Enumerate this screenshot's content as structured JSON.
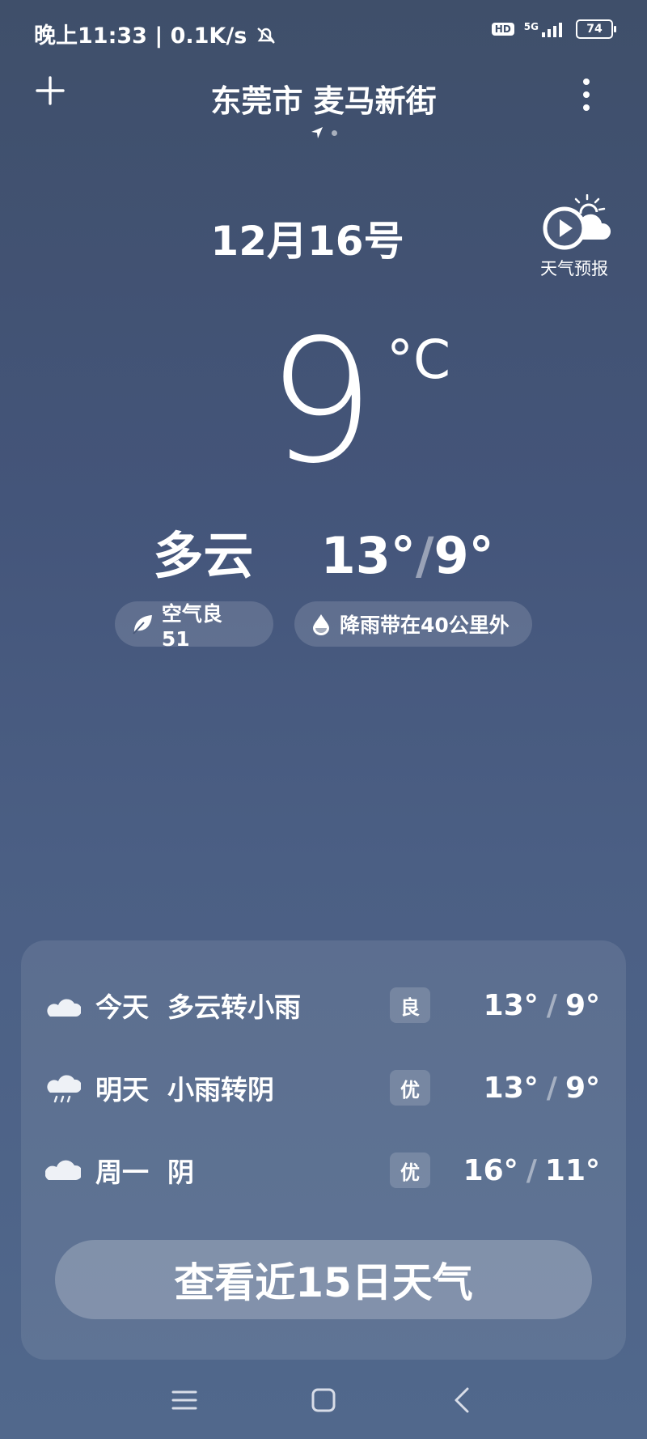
{
  "status_bar": {
    "time_speed": "晚上11:33 | 0.1K/s",
    "hd": "HD",
    "network": "5G",
    "battery": "74"
  },
  "header": {
    "city": "东莞市 麦马新街"
  },
  "date": "12月16号",
  "forecast_video_label": "天气预报",
  "current": {
    "temp": "9",
    "unit": "°C",
    "condition": "多云",
    "high": "13°",
    "low": "9°"
  },
  "chips": {
    "aqi": "空气良 51",
    "rain": "降雨带在40公里外"
  },
  "forecast": [
    {
      "day": "今天",
      "desc": "多云转小雨",
      "aqi": "良",
      "high": "13°",
      "low": "9°",
      "icon": "cloud-moon-icon"
    },
    {
      "day": "明天",
      "desc": "小雨转阴",
      "aqi": "优",
      "high": "13°",
      "low": "9°",
      "icon": "light-rain-icon"
    },
    {
      "day": "周一",
      "desc": "阴",
      "aqi": "优",
      "high": "16°",
      "low": "11°",
      "icon": "cloud-icon"
    }
  ],
  "fifteen_day_button": "查看近15日天气",
  "slash": "/"
}
